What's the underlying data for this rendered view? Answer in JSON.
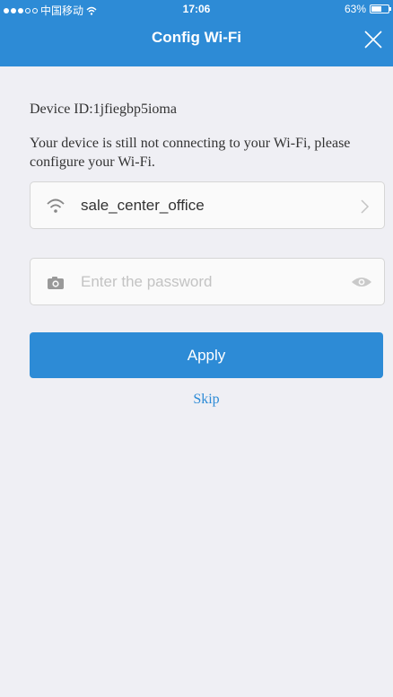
{
  "status_bar": {
    "carrier": "中国移动",
    "time": "17:06",
    "battery_text": "63%",
    "battery_level": 0.63
  },
  "nav": {
    "title": "Config Wi-Fi",
    "close_icon": "close-icon"
  },
  "content": {
    "device_id": "Device ID:1jfiegbp5ioma",
    "message": "Your device is still not connecting to your Wi-Fi, please configure your Wi-Fi."
  },
  "wifi": {
    "icon": "wifi-icon",
    "ssid": "sale_center_office",
    "chevron_icon": "chevron-right-icon"
  },
  "password": {
    "icon": "camera-icon",
    "placeholder": "Enter the password",
    "value": "",
    "toggle_icon": "eye-icon"
  },
  "actions": {
    "apply_label": "Apply",
    "skip_label": "Skip"
  },
  "colors": {
    "primary": "#2d8bd6",
    "background": "#efeff4"
  }
}
